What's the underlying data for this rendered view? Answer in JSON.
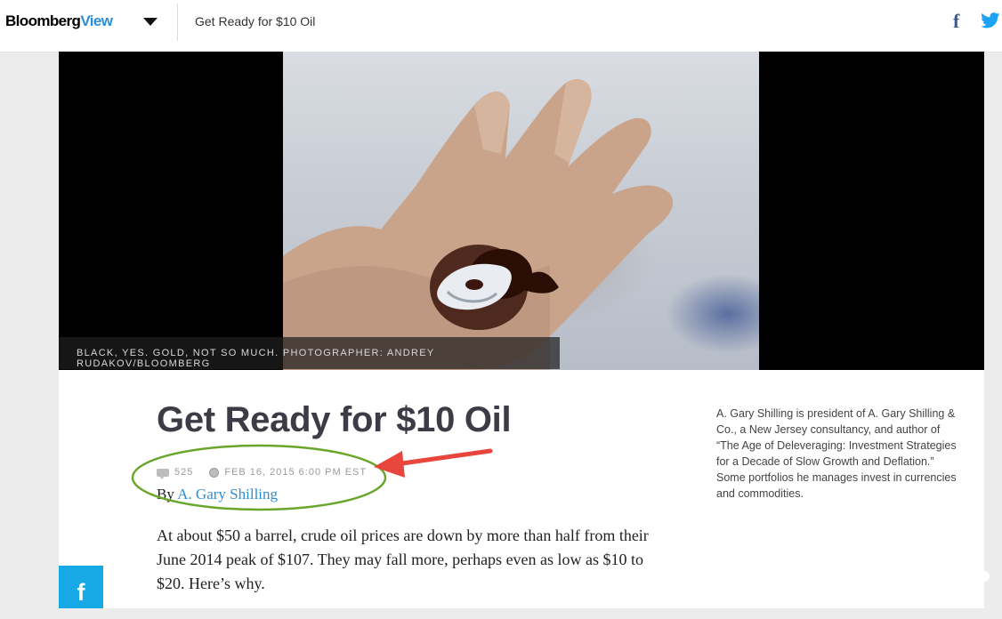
{
  "header": {
    "logo_primary": "Bloomberg",
    "logo_secondary": "View",
    "title": "Get Ready for $10 Oil",
    "share_facebook": "f",
    "twitter_icon": "twitter-bird-icon"
  },
  "hero": {
    "caption": "BLACK, YES. GOLD, NOT SO MUCH. PHOTOGRAPHER: ANDREY RUDAKOV/BLOOMBERG"
  },
  "article": {
    "headline": "Get Ready for $10 Oil",
    "comment_count": "525",
    "timestamp": "FEB 16, 2015 6:00 PM EST",
    "byline_prefix": "By",
    "author": "A. Gary Shilling",
    "body": "At about $50 a barrel, crude oil prices are down by more than half from their June 2014 peak of $107. They may fall more, perhaps even as low as $10 to $20. Here’s why."
  },
  "sidebar": {
    "author_bio": "A. Gary Shilling is president of A. Gary Shilling & Co., a New Jersey consultancy, and author of “The Age of Deleveraging: Investment Strategies for a Decade of Slow Growth and Deflation.” Some portfolios he manages invest in currencies and commodities."
  },
  "floating_share": {
    "facebook_label": "f"
  },
  "colors": {
    "brand_blue": "#2a8fd8",
    "facebook": "#3b5998",
    "twitter": "#1da1f2",
    "share_bar": "#17a9e6",
    "annotation_arrow": "#e8453c",
    "annotation_ellipse": "#6aa62c"
  }
}
